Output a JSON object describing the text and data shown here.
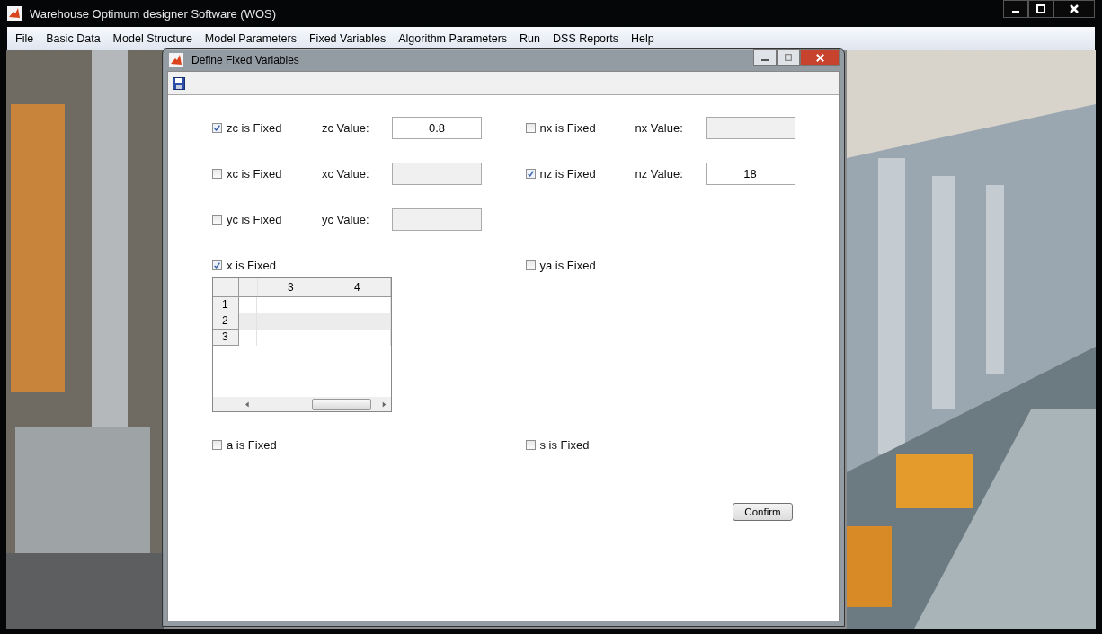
{
  "window": {
    "title": "Warehouse Optimum designer Software (WOS)"
  },
  "menu": [
    "File",
    "Basic Data",
    "Model Structure",
    "Model Parameters",
    "Fixed Variables",
    "Algorithm Parameters",
    "Run",
    "DSS Reports",
    "Help"
  ],
  "dialog": {
    "title": "Define Fixed Variables",
    "rows": [
      [
        {
          "kind": "value",
          "label": "zc is Fixed",
          "checked": true,
          "value_label": "zc Value:",
          "value": "0.8"
        },
        {
          "kind": "value",
          "label": "nx is Fixed",
          "checked": false,
          "value_label": "nx Value:"
        }
      ],
      [
        {
          "kind": "value",
          "label": "xc is Fixed",
          "checked": false,
          "value_label": "xc Value:"
        },
        {
          "kind": "value",
          "label": "nz is Fixed",
          "checked": true,
          "value_label": "nz Value:",
          "value": "18"
        }
      ],
      [
        {
          "kind": "value",
          "label": "yc is Fixed",
          "checked": false,
          "value_label": "yc Value:"
        }
      ],
      [
        {
          "kind": "table",
          "label": "x is Fixed",
          "checked": true,
          "table": {
            "columns": [
              "3",
              "4"
            ],
            "rows": [
              "1",
              "2",
              "3"
            ]
          }
        },
        {
          "kind": "plain",
          "label": "ya is Fixed",
          "checked": false
        }
      ],
      [
        {
          "kind": "plain",
          "label": "a is Fixed",
          "checked": false
        },
        {
          "kind": "plain",
          "label": "s is Fixed",
          "checked": false
        }
      ]
    ],
    "confirm": "Confirm"
  }
}
